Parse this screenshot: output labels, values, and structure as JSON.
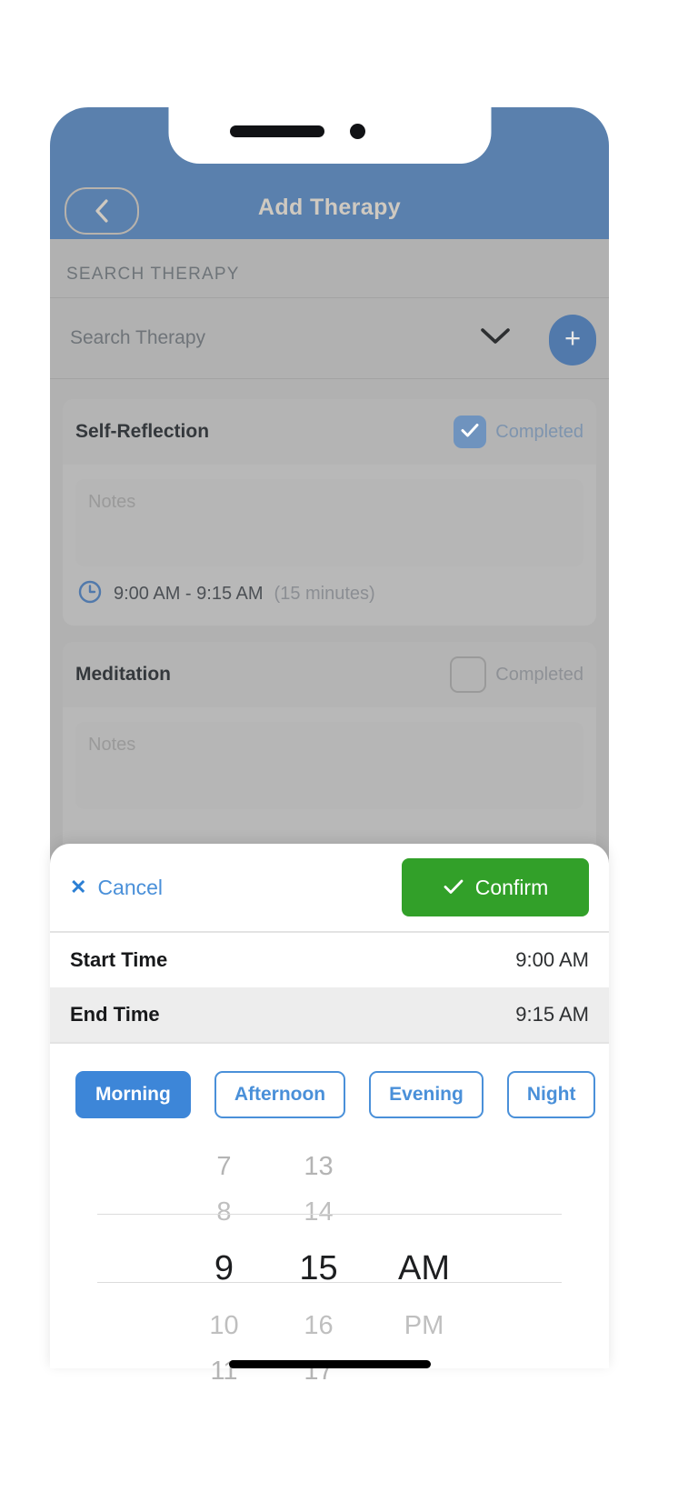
{
  "header": {
    "title": "Add Therapy",
    "back_icon": "chevron-left-icon"
  },
  "background": {
    "section_label": "SEARCH THERAPY",
    "search": {
      "placeholder": "Search Therapy",
      "dropdown_icon": "chevron-down-icon",
      "add_icon": "plus-icon"
    },
    "cards": [
      {
        "title": "Self-Reflection",
        "completed_label": "Completed",
        "completed": true,
        "notes_placeholder": "Notes",
        "clock_icon": "clock-icon",
        "time_range": "9:00 AM - 9:15 AM",
        "duration": "(15 minutes)"
      },
      {
        "title": "Meditation",
        "completed_label": "Completed",
        "completed": false,
        "notes_placeholder": "Notes"
      }
    ]
  },
  "sheet": {
    "cancel_label": "Cancel",
    "cancel_icon": "close-icon",
    "confirm_label": "Confirm",
    "confirm_icon": "check-icon",
    "confirm_color": "#32a029",
    "accent_color": "#4a90d9",
    "rows": [
      {
        "label": "Start Time",
        "value": "9:00 AM",
        "selected": false
      },
      {
        "label": "End Time",
        "value": "9:15 AM",
        "selected": true
      }
    ],
    "period_chips": [
      {
        "label": "Morning",
        "active": true
      },
      {
        "label": "Afternoon",
        "active": false
      },
      {
        "label": "Evening",
        "active": false
      },
      {
        "label": "Night",
        "active": false
      }
    ],
    "picker": {
      "hours": [
        "7",
        "8",
        "9",
        "10",
        "11"
      ],
      "minutes": [
        "13",
        "14",
        "15",
        "16",
        "17"
      ],
      "meridiem": [
        "",
        "",
        "AM",
        "PM",
        ""
      ],
      "selected_hour": "9",
      "selected_minute": "15",
      "selected_meridiem": "AM"
    }
  }
}
